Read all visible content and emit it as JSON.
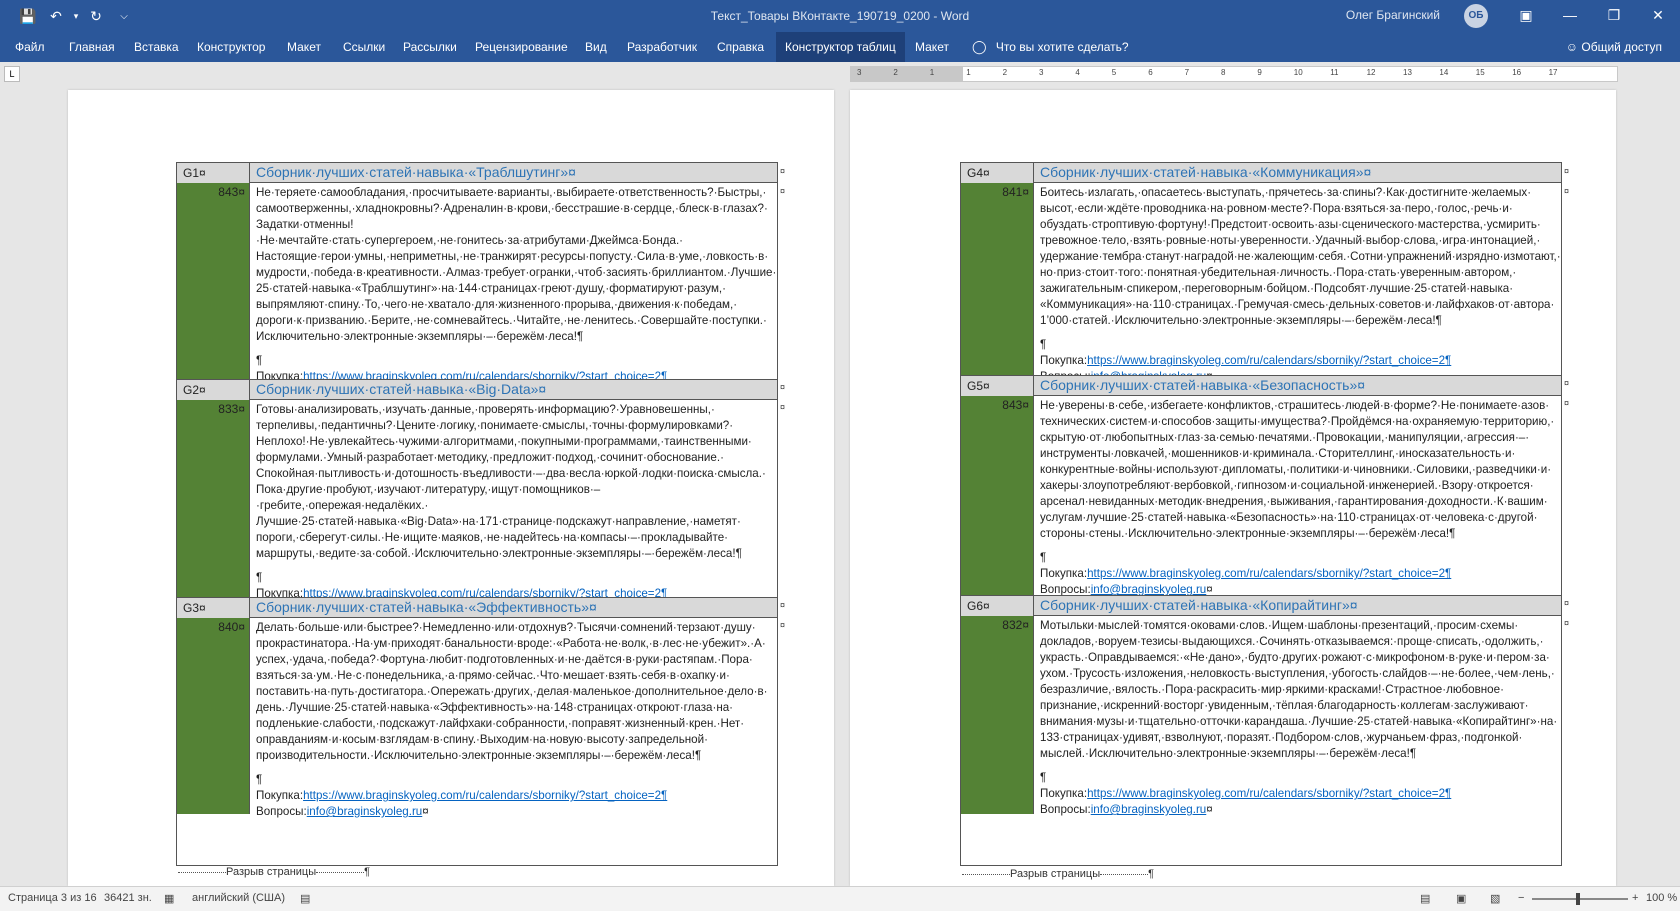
{
  "window": {
    "doc_title": "Текст_Товары ВКонтакте_190719_0200 - Word",
    "user_name": "Олег Брагинский",
    "avatar_initials": "ОБ"
  },
  "ribbon": {
    "tabs": [
      {
        "label": "Файл"
      },
      {
        "label": "Главная"
      },
      {
        "label": "Вставка"
      },
      {
        "label": "Конструктор"
      },
      {
        "label": "Макет"
      },
      {
        "label": "Ссылки"
      },
      {
        "label": "Рассылки"
      },
      {
        "label": "Рецензирование"
      },
      {
        "label": "Вид"
      },
      {
        "label": "Разработчик"
      },
      {
        "label": "Справка"
      },
      {
        "label": "Конструктор таблиц"
      },
      {
        "label": "Макет"
      }
    ],
    "tell_me": "Что вы хотите сделать?",
    "share": "Общий доступ"
  },
  "ruler": {
    "labels": [
      "3",
      "2",
      "1",
      "1",
      "2",
      "3",
      "4",
      "5",
      "6",
      "7",
      "8",
      "9",
      "10",
      "11",
      "12",
      "13",
      "14",
      "15",
      "16",
      "17"
    ]
  },
  "link_label": "Покупка:",
  "link_url": "https://www.braginskyoleg.com/ru/calendars/sborniky/?start_choice=2¶",
  "question_label": "Вопросы:",
  "email": "info@braginskyoleg.ru",
  "email_mark": "¤",
  "pilcrow": "¶",
  "page_break": "Разрыв страницы",
  "pages": [
    {
      "rows": [
        {
          "id": "G1¤",
          "num": "843¤",
          "title": "Сборник·лучших·статей·навыка·«Траблшутинг»¤",
          "lines": [
            "Не·теряете·самообладания,·просчитываете·варианты,·выбираете·ответственность?·Быстры,·",
            "самоотверженны,·хладнокровны?·Адреналин·в·крови,·бесстрашие·в·сердце,·блеск·в·глазах?·",
            "Задатки·отменны!·Не·мечтайте·стать·супергероем,·не·гонитесь·за·атрибутами·Джеймса·Бонда.·",
            "Настоящие·герои·умны,·неприметны,·не·транжирят·ресурсы·попусту.·Сила·в·уме,·ловкость·в·",
            "мудрости,·победа·в·креативности.·Алмаз·требует·огранки,·чтоб·засиять·бриллиантом.·Лучшие·",
            "25·статей·навыка·«Траблшутинг»·на·144·страницах·греют·душу,·форматируют·разум,·",
            "выпрямляют·спину.·То,·чего·не·хватало·для·жизненного·прорыва,·движения·к·победам,·",
            "дороги·к·призванию.·Берите,·не·сомневайтесь.·Читайте,·не·ленитесь.·Совершайте·поступки.·",
            "Исключительно·электронные·экземпляры·–·бережём·леса!¶"
          ]
        },
        {
          "id": "G2¤",
          "num": "833¤",
          "title": "Сборник·лучших·статей·навыка·«Big·Data»¤",
          "lines": [
            "Готовы·анализировать,·изучать·данные,·проверять·информацию?·Уравновешенны,·",
            "терпеливы,·педантичны?·Цените·логику,·понимаете·смыслы,·точны·формулировками?·",
            "Неплохо!·Не·увлекайтесь·чужими·алгоритмами,·покупными·программами,·таинственными·",
            "формулами.·Умный·разработает·методику,·предложит·подход,·сочинит·обоснование.·",
            "Спокойная·пытливость·и·дотошность·въедливости·–·два·весла·юркой·лодки·поиска·смысла.·",
            "Пока·другие·пробуют,·изучают·литературу,·ищут·помощников·–·гребите,·опережая·недалёких.·",
            "Лучшие·25·статей·навыка·«Big·Data»·на·171·странице·подскажут·направление,·наметят·",
            "пороги,·сберегут·силы.·Не·ищите·маяков,·не·надейтесь·на·компасы·–·прокладывайте·",
            "маршруты,·ведите·за·собой.·Исключительно·электронные·экземпляры·–·бережём·леса!¶"
          ]
        },
        {
          "id": "G3¤",
          "num": "840¤",
          "title": "Сборник·лучших·статей·навыка·«Эффективность»¤",
          "lines": [
            "Делать·больше·или·быстрее?·Немедленно·или·отдохнув?·Тысячи·сомнений·терзают·душу·",
            "прокрастинатора.·На·ум·приходят·банальности·вроде:·«Работа·не·волк,·в·лес·не·убежит».·А·",
            "успех,·удача,·победа?·Фортуна·любит·подготовленных·и·не·даётся·в·руки·растяпам.·Пора·",
            "взяться·за·ум.·Не·с·понедельника,·а·прямо·сейчас.·Что·мешает·взять·себя·в·охапку·и·",
            "поставить·на·путь·достигатора.·Опережать·других,·делая·маленькое·дополнительное·дело·в·",
            "день.·Лучшие·25·статей·навыка·«Эффективность»·на·148·страницах·откроют·глаза·на·",
            "подленькие·слабости,·подскажут·лайфхаки·собранности,·поправят·жизненный·крен.·Нет·",
            "оправданиям·и·косым·взглядам·в·спину.·Выходим·на·новую·высоту·запредельной·",
            "производительности.·Исключительно·электронные·экземпляры·–·бережём·леса!¶"
          ]
        }
      ]
    },
    {
      "rows": [
        {
          "id": "G4¤",
          "num": "841¤",
          "title": "Сборник·лучших·статей·навыка·«Коммуникация»¤",
          "lines": [
            "Боитесь·излагать,·опасаетесь·выступать,·прячетесь·за·спины?·Как·достигните·желаемых·",
            "высот,·если·ждёте·проводника·на·ровном·месте?·Пора·взяться·за·перо,·голос,·речь·и·",
            "обуздать·строптивую·фортуну!·Предстоит·освоить·азы·сценического·мастерства,·усмирить·",
            "тревожное·тело,·взять·ровные·ноты·уверенности.·Удачный·выбор·слова,·игра·интонацией,·",
            "удержание·тембра·станут·наградой·не·жалеющим·себя.·Сотни·упражнений·изрядно·измотают,·",
            "но·приз·стоит·того:·понятная·убедительная·личность.·Пора·стать·уверенным·автором,·",
            "зажигательным·спикером,·переговорным·бойцом.·Подсобят·лучшие·25·статей·навыка·",
            "«Коммуникация»·на·110·страницах.·Гремучая·смесь·дельных·советов·и·лайфхаков·от·автора·",
            "1’000·статей.·Исключительно·электронные·экземпляры·–·бережём·леса!¶"
          ]
        },
        {
          "id": "G5¤",
          "num": "843¤",
          "title": "Сборник·лучших·статей·навыка·«Безопасность»¤",
          "lines": [
            "Не·уверены·в·себе,·избегаете·конфликтов,·страшитесь·людей·в·форме?·Не·понимаете·азов·",
            "технических·систем·и·способов·защиты·имущества?·Пройдёмся·на·охраняемую·территорию,·",
            "скрытую·от·любопытных·глаз·за·семью·печатями.·Провокации,·манипуляции,·агрессия·–·",
            "инструменты·ловкачей,·мошенников·и·криминала.·Сторителлинг,·иносказательность·и·",
            "конкурентные·войны·используют·дипломаты,·политики·и·чиновники.·Силовики,·разведчики·и·",
            "хакеры·злоупотребляют·вербовкой,·гипнозом·и·социальной·инженерией.·Взору·откроется·",
            "арсенал·невиданных·методик·внедрения,·выживания,·гарантирования·доходности.·К·вашим·",
            "услугам·лучшие·25·статей·навыка·«Безопасность»·на·110·страницах·от·человека·с·другой·",
            "стороны·стены.·Исключительно·электронные·экземпляры·–·бережём·леса!¶"
          ]
        },
        {
          "id": "G6¤",
          "num": "832¤",
          "title": "Сборник·лучших·статей·навыка·«Копирайтинг»¤",
          "lines": [
            "Мотыльки·мыслей·томятся·оковами·слов.·Ищем·шаблоны·презентаций,·просим·схемы·",
            "докладов,·воруем·тезисы·выдающихся.·Сочинять·отказываемся:·проще·списать,·одолжить,·",
            "украсть.·Оправдываемся:·«Не·дано»,·будто·других·рожают·с·микрофоном·в·руке·и·пером·за·",
            "ухом.·Трусость·изложения,·неловкость·выступления,·убогость·слайдов·–·не·более,·чем·лень,·",
            "безразличие,·вялость.·Пора·раскрасить·мир·яркими·красками!·Страстное·любовное·",
            "признание,·искренний·восторг·увиденным,·тёплая·благодарность·коллегам·заслуживают·",
            "внимания·музы·и·тщательно·отточки·карандаша.·Лучшие·25·статей·навыка·«Копирайтинг»·на·",
            "133·страницах·удивят,·взволнуют,·поразят.·Подбором·слов,·журчаньем·фраз,·подгонкой·",
            "мыслей.·Исключительно·электронные·экземпляры·–·бережём·леса!¶"
          ]
        }
      ]
    }
  ],
  "status": {
    "page": "Страница 3 из 16",
    "words": "36421 зн.",
    "language": "английский (США)",
    "zoom": "100 %"
  }
}
